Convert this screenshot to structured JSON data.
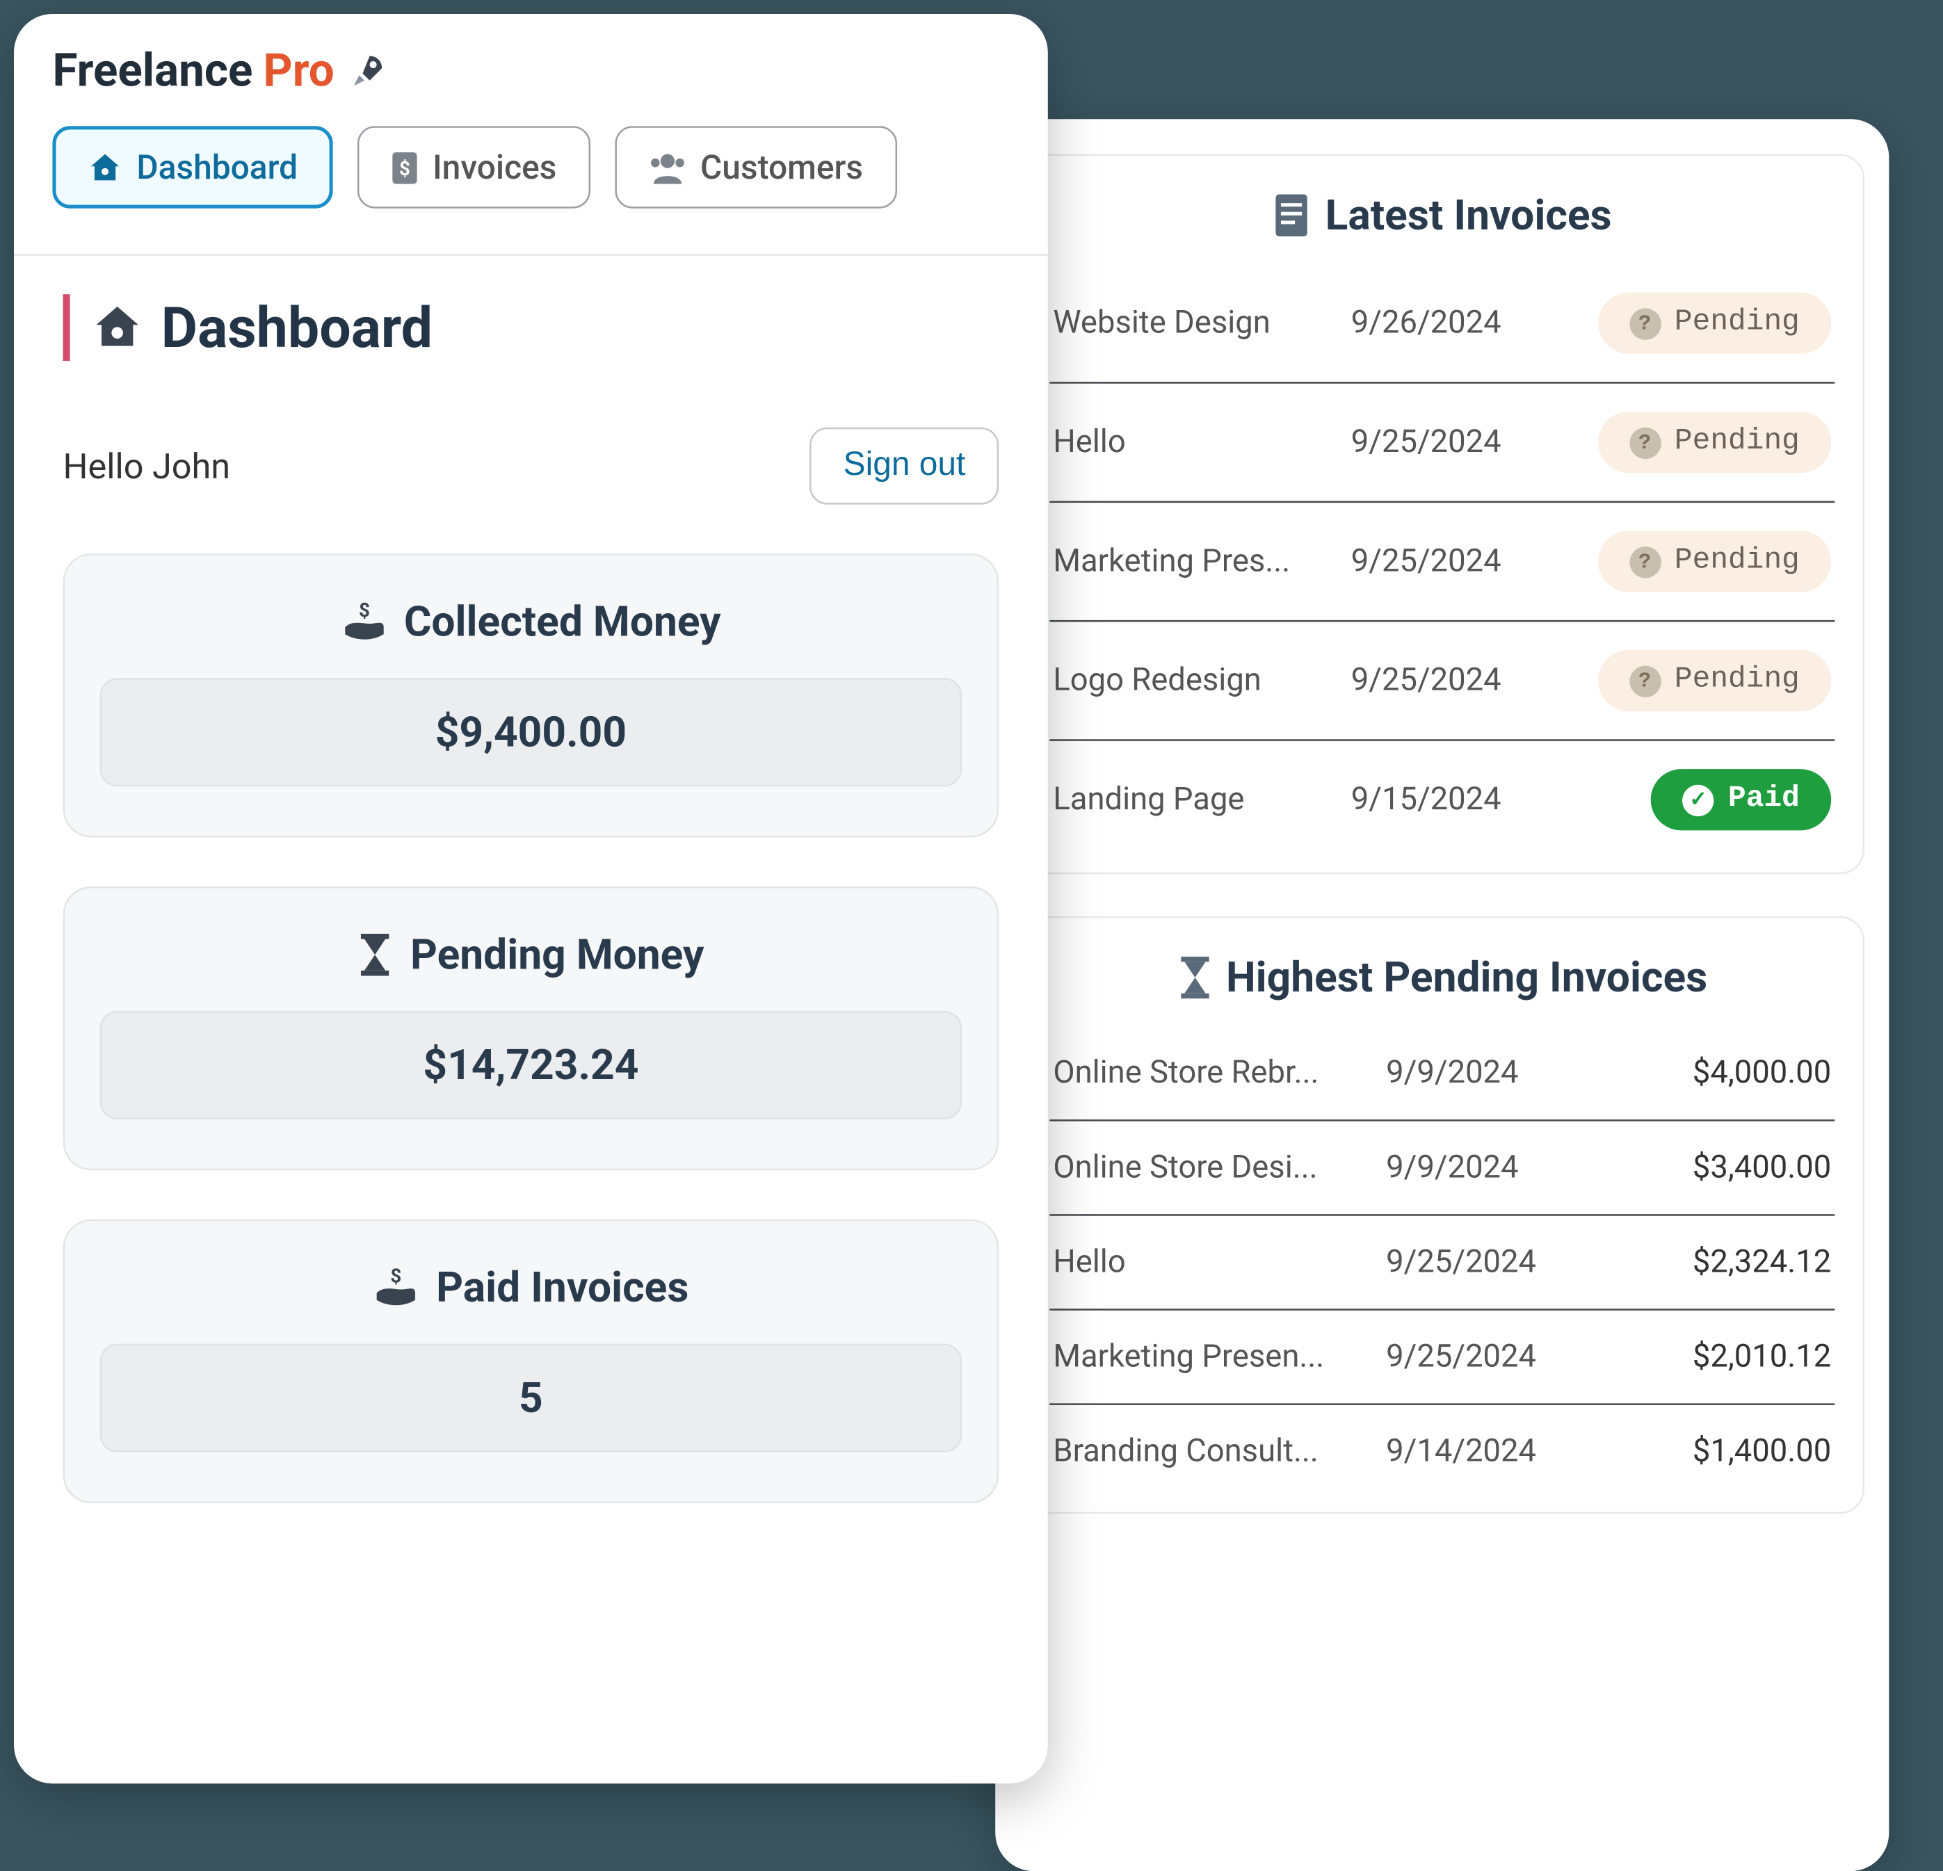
{
  "brand": {
    "name": "Freelance",
    "suffix": "Pro"
  },
  "tabs": [
    {
      "label": "Dashboard",
      "active": true
    },
    {
      "label": "Invoices",
      "active": false
    },
    {
      "label": "Customers",
      "active": false
    }
  ],
  "page": {
    "title": "Dashboard"
  },
  "greeting": "Hello John",
  "signout_label": "Sign out",
  "stats": [
    {
      "label": "Collected Money",
      "value": "$9,400.00",
      "icon": "hand-money-icon"
    },
    {
      "label": "Pending Money",
      "value": "$14,723.24",
      "icon": "hourglass-icon"
    },
    {
      "label": "Paid Invoices",
      "value": "5",
      "icon": "hand-money-icon"
    }
  ],
  "latest": {
    "title": "Latest Invoices",
    "rows": [
      {
        "name": "Website Design",
        "date": "9/26/2024",
        "status": "Pending"
      },
      {
        "name": "Hello",
        "date": "9/25/2024",
        "status": "Pending"
      },
      {
        "name": "Marketing Pres...",
        "date": "9/25/2024",
        "status": "Pending"
      },
      {
        "name": "Logo Redesign",
        "date": "9/25/2024",
        "status": "Pending"
      },
      {
        "name": "Landing Page",
        "date": "9/15/2024",
        "status": "Paid"
      }
    ]
  },
  "highest": {
    "title": "Highest Pending Invoices",
    "rows": [
      {
        "name": "Online Store Rebr...",
        "date": "9/9/2024",
        "amount": "$4,000.00"
      },
      {
        "name": "Online Store Desi...",
        "date": "9/9/2024",
        "amount": "$3,400.00"
      },
      {
        "name": "Hello",
        "date": "9/25/2024",
        "amount": "$2,324.12"
      },
      {
        "name": "Marketing Presen...",
        "date": "9/25/2024",
        "amount": "$2,010.12"
      },
      {
        "name": "Branding Consult...",
        "date": "9/14/2024",
        "amount": "$1,400.00"
      }
    ]
  }
}
